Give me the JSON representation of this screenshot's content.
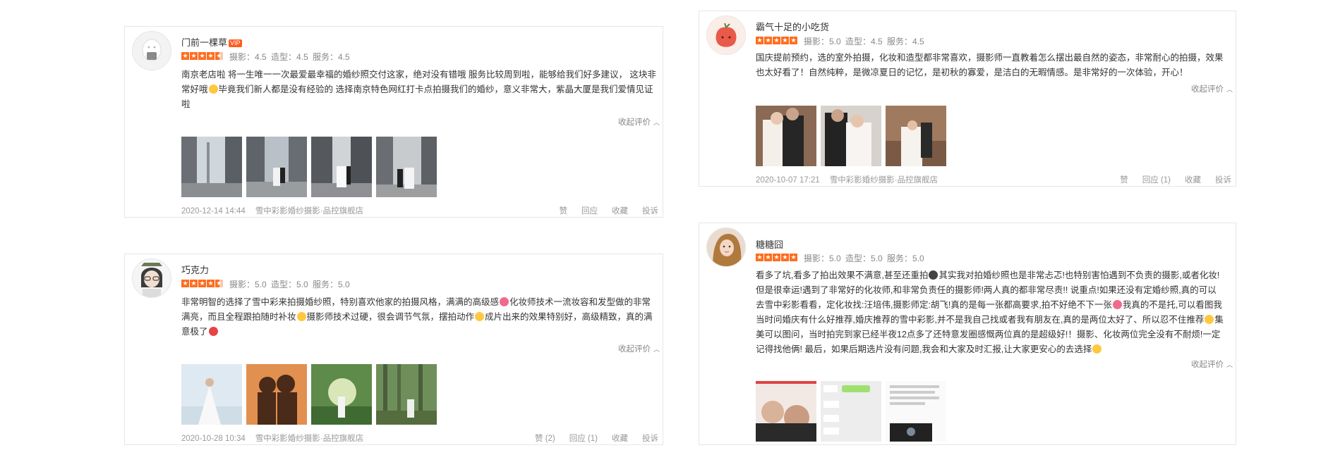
{
  "reviews": [
    {
      "name": "门前一棵草",
      "vip": "VIP",
      "rating": 4.5,
      "scores": "摄影：4.5 造型：4.5 服务：4.5",
      "text_a": "南京老店啦 将一生唯一一次最爱最幸福的婚纱照交付这家，绝对没有错哦 服务比较周到啦，能够给我们好多建议， 这块非常好哦",
      "text_b": "毕竟我们新人都是没有经验的 选择南京特色网红打卡点拍摄我们的婚纱，意义非常大，紫晶大厦是我们爱情见证啦",
      "collapse": "收起评价",
      "date": "2020-12-14 14:44",
      "shop": "雪中彩影婚纱摄影·品控旗舰店",
      "actions": {
        "like": "赞",
        "reply": "回应",
        "fav": "收藏",
        "report": "投诉"
      }
    },
    {
      "name": "霸气十足的小吃货",
      "rating": 5.0,
      "scores": "摄影：5.0 造型：4.5 服务：4.5",
      "text": "国庆提前预约，选的室外拍摄，化妆和造型都非常喜欢，摄影师一直教着怎么摆出最自然的姿态，非常耐心的拍摄，效果也太好看了！自然纯粹，是微凉夏日的记忆，是初秋的寡爱，是洁白的无暇情感。是非常好的一次体验，开心！",
      "collapse": "收起评价",
      "date": "2020-10-07 17:21",
      "shop": "雪中彩影婚纱摄影·品控旗舰店",
      "actions": {
        "like": "赞",
        "reply": "回应 (1)",
        "fav": "收藏",
        "report": "投诉"
      }
    },
    {
      "name": "巧克力",
      "rating": 4.5,
      "scores": "摄影：5.0 造型：5.0 服务：5.0",
      "text_a": "非常明智的选择了雪中彩来拍摄婚纱照，特别喜欢他家的拍摄风格，满满的高级感",
      "text_b": "化妆师技术一流妆容和发型做的非常满亮，而且全程跟拍随时补妆",
      "text_c": "摄影师技术过硬，很会调节气氛，摆拍动作",
      "text_d": "成片出来的效果特别好，高级精致，真的满意极了",
      "collapse": "收起评价",
      "date": "2020-10-28 10:34",
      "shop": "雪中彩影婚纱摄影·品控旗舰店",
      "actions": {
        "like": "赞 (2)",
        "reply": "回应 (1)",
        "fav": "收藏",
        "report": "投诉"
      }
    },
    {
      "name": "糖糖囧",
      "rating": 5.0,
      "scores": "摄影：5.0 造型：5.0 服务：5.0",
      "text_a": "看多了坑,看多了拍出效果不满意,甚至还重拍",
      "text_b": "其实我对拍婚纱照也是非常忐忑!也特别害怕遇到不负责的摄影,或者化妆!但是很幸运!遇到了非常好的化妆师,和非常负责任的摄影师!两人真的都非常尽责!! 说重点!如果还没有定婚纱照,真的可以去雪中彩影看看，定化妆找:汪培伟,摄影师定:胡飞!真的是每一张都高要求,拍不好绝不下一张",
      "text_c": "我真的不是托,可以看图",
      "text_d": "我当时问婚庆有什么好推荐,婚庆推荐的雪中彩影,并不是我自己找或者我有朋友在,真的是两位太好了、所以忍不住推荐",
      "text_e": "集美可以图问，当时拍完到家已经半夜12点多了还特意发圈感慨两位真的是超级好!！摄影、化妆两位完全没有不耐烦!一定记得找他俩! 最后，如果后期选片没有问题,我会和大家及时汇报,让大家更安心的去选择",
      "collapse": "收起评价"
    }
  ]
}
